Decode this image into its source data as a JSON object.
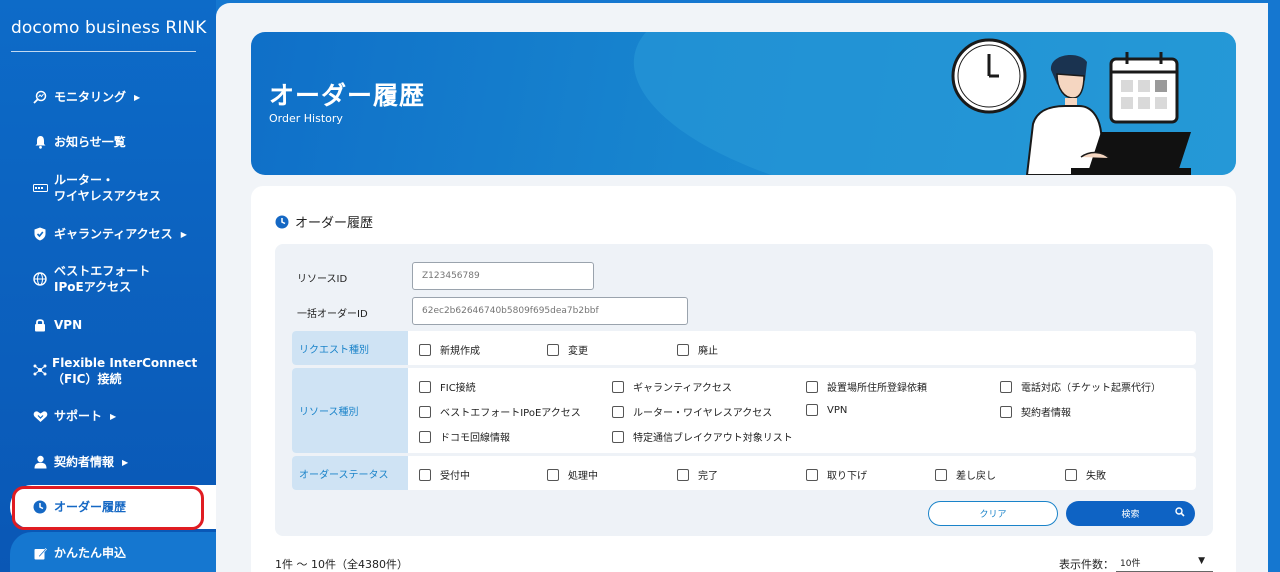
{
  "sidebar": {
    "brand": "docomo business RINK",
    "items": [
      {
        "label": "モニタリング",
        "arrow": "▶"
      },
      {
        "label": "お知らせ一覧"
      },
      {
        "label": "ルーター・",
        "label2": "ワイヤレスアクセス"
      },
      {
        "label": "ギャランティアクセス",
        "arrow": "▶"
      },
      {
        "label": "ベストエフォート",
        "label2": "IPoEアクセス"
      },
      {
        "label": "VPN"
      },
      {
        "label": "Flexible InterConnect",
        "label2": "（FIC）接続"
      },
      {
        "label": "サポート",
        "arrow": "▶"
      },
      {
        "label": "契約者情報",
        "arrow": "▶"
      },
      {
        "label": "オーダー履歴"
      },
      {
        "label": "かんたん申込"
      }
    ]
  },
  "hero": {
    "title": "オーダー履歴",
    "subtitle": "Order History"
  },
  "card": {
    "title": "オーダー履歴"
  },
  "search": {
    "resource_id_label": "リソースID",
    "resource_id_placeholder": "Z123456789",
    "bulk_order_id_label": "一括オーダーID",
    "bulk_order_id_placeholder": "62ec2b62646740b5809f695dea7b2bbf",
    "request_type": {
      "label": "リクエスト種別",
      "options": [
        "新規作成",
        "変更",
        "廃止"
      ]
    },
    "resource_type": {
      "label": "リソース種別",
      "options": [
        "FIC接続",
        "ギャランティアクセス",
        "設置場所住所登録依頼",
        "電話対応（チケット起票代行）",
        "ベストエフォートIPoEアクセス",
        "ルーター・ワイヤレスアクセス",
        "VPN",
        "契約者情報",
        "ドコモ回線情報",
        "特定通信ブレイクアウト対象リスト"
      ]
    },
    "order_status": {
      "label": "オーダーステータス",
      "options": [
        "受付中",
        "処理中",
        "完了",
        "取り下げ",
        "差し戻し",
        "失敗"
      ]
    },
    "clear_label": "クリア",
    "search_label": "検索"
  },
  "results": {
    "count_text": "1件 〜 10件（全4380件）",
    "per_page_label": "表示件数：",
    "per_page_value": "10件"
  },
  "colors": {
    "accent": "#0e63c4",
    "sidebar_bg": "#0d6bc8",
    "highlight_outline": "#e01c22",
    "row_head_bg": "#cfe3f4"
  }
}
